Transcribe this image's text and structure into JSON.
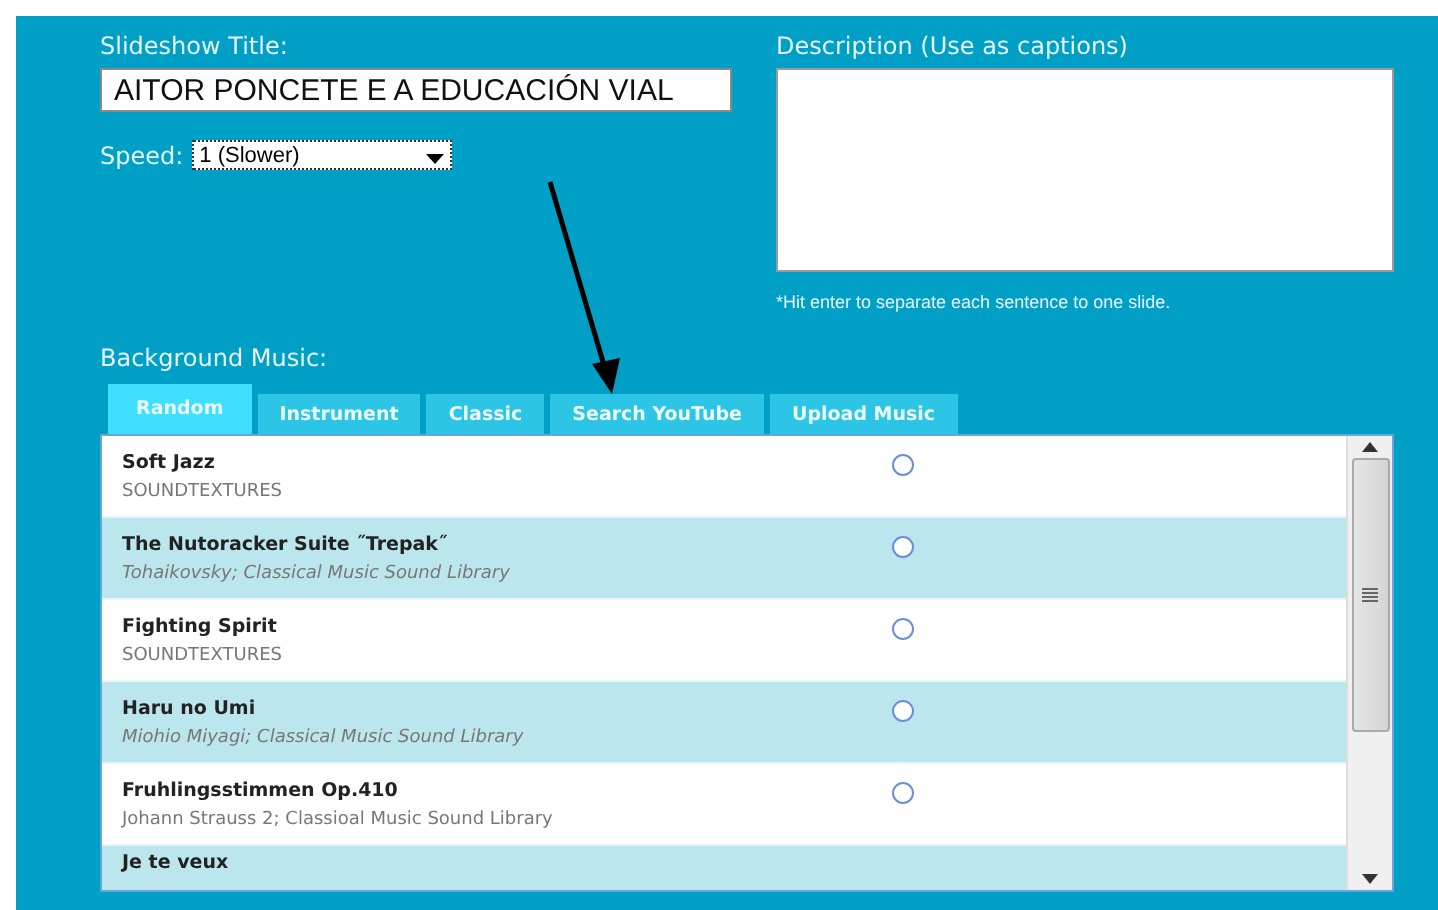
{
  "title_label": "Slideshow Title:",
  "title_value": "AITOR PONCETE E A EDUCACIÓN VIAL",
  "speed_label": "Speed:",
  "speed_value": "1 (Slower)",
  "description_label": "Description (Use as captions)",
  "description_hint": "*Hit enter to separate each sentence to one slide.",
  "music_label": "Background Music:",
  "tabs": [
    {
      "label": "Random",
      "selected": true
    },
    {
      "label": "Instrument",
      "selected": false
    },
    {
      "label": "Classic",
      "selected": false
    },
    {
      "label": "Search YouTube",
      "selected": false
    },
    {
      "label": "Upload Music",
      "selected": false
    }
  ],
  "tracks": [
    {
      "title": "Soft Jazz",
      "artist": "SOUNDTEXTURES",
      "selected": false
    },
    {
      "title": "The Nutoracker Suite ˝Trepak˝",
      "artist": "Tohaikovsky; Classical Music Sound Library",
      "selected": false
    },
    {
      "title": "Fighting Spirit",
      "artist": "SOUNDTEXTURES",
      "selected": false
    },
    {
      "title": "Haru no Umi",
      "artist": "Miohio Miyagi; Classical Music Sound Library",
      "selected": false
    },
    {
      "title": "Fruhlingsstimmen Op.410",
      "artist": "Johann Strauss 2; Classioal Music Sound Library",
      "selected": false
    },
    {
      "title": "Je te veux"
    }
  ]
}
